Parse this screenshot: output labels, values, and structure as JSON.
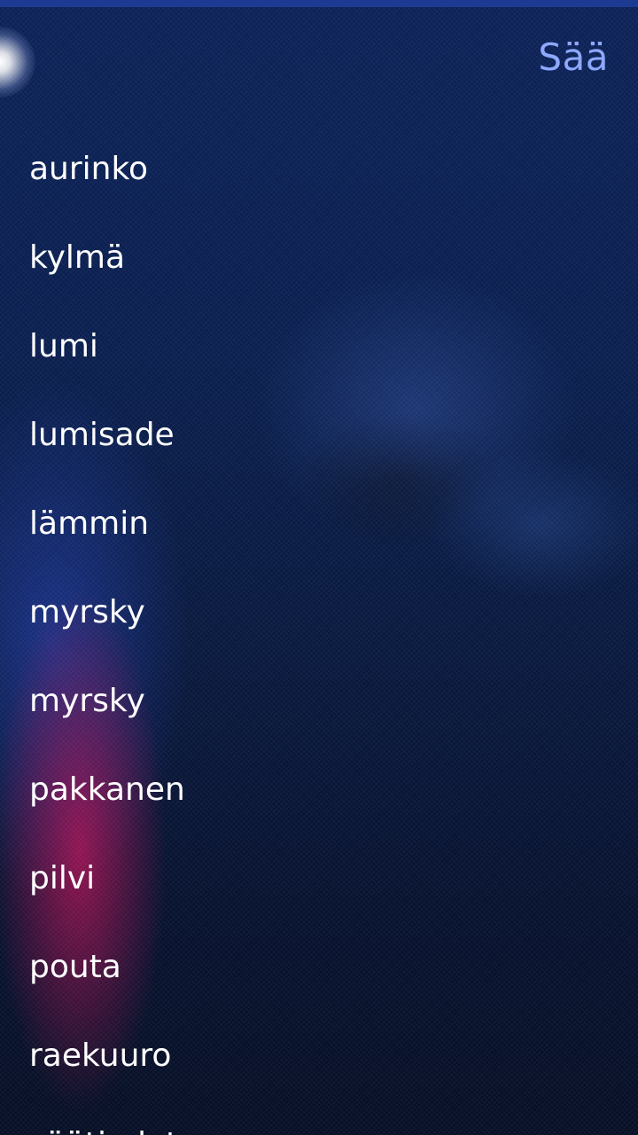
{
  "header": {
    "title": "Sää"
  },
  "words": [
    "aurinko",
    "kylmä",
    "lumi",
    "lumisade",
    "lämmin",
    "myrsky",
    "myrsky",
    "pakkanen",
    "pilvi",
    "pouta",
    "raekuuro",
    "säätiedotus"
  ],
  "colors": {
    "accent": "#8ea8ff",
    "text": "#ffffff",
    "top_bar": "#1d3a92"
  }
}
